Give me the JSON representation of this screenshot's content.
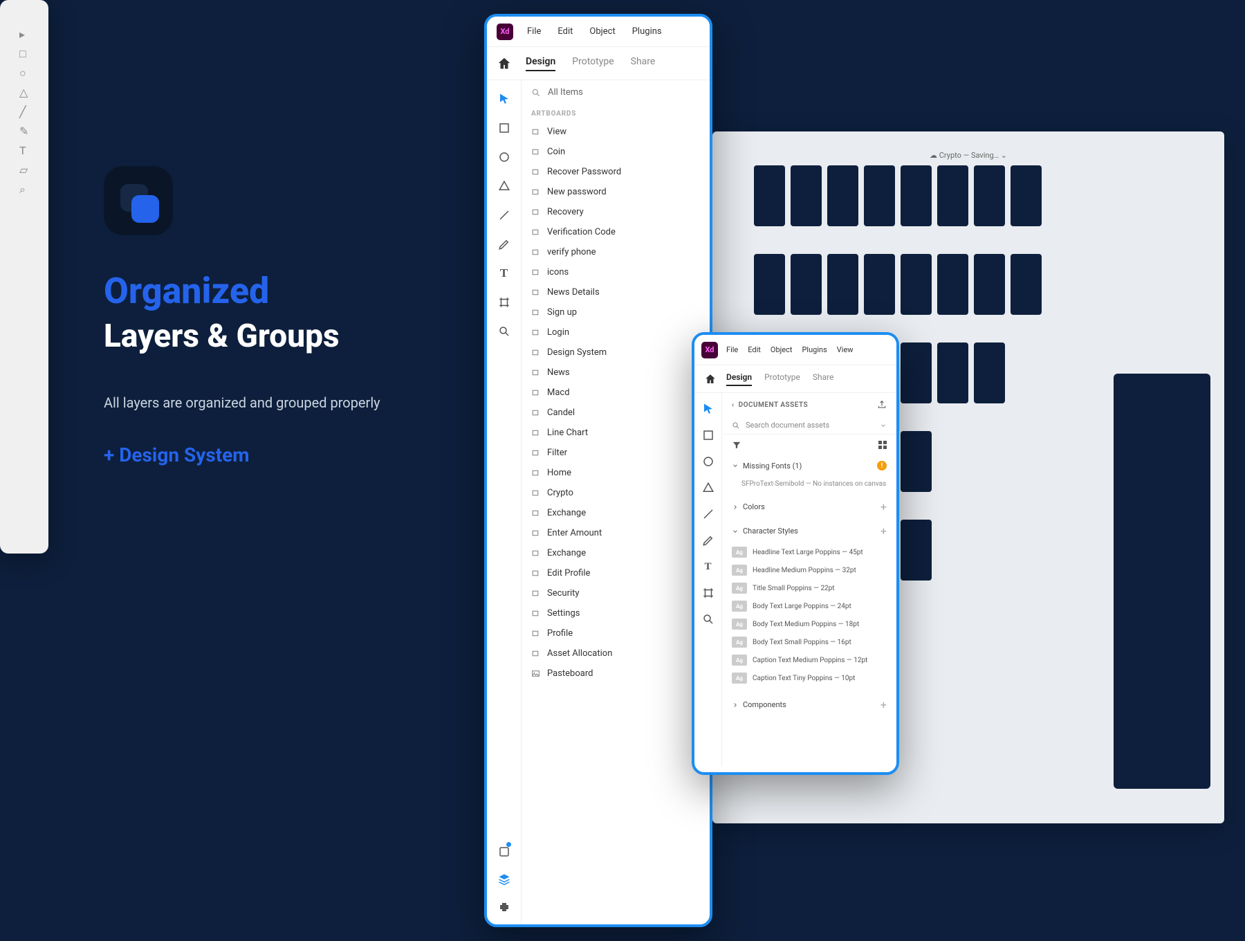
{
  "marketing": {
    "h1": "Organized",
    "h2": "Layers & Groups",
    "desc": "All layers are organized and grouped properly",
    "tag": "+ Design System"
  },
  "xd": {
    "logo": "Xd",
    "menu": {
      "file": "File",
      "edit": "Edit",
      "object": "Object",
      "plugins": "Plugins",
      "view": "View"
    },
    "tabs": {
      "design": "Design",
      "prototype": "Prototype",
      "share": "Share"
    }
  },
  "layers": {
    "search": "All Items",
    "section": "ARTBOARDS",
    "items": [
      "View",
      "Coin",
      "Recover Password",
      "New password",
      "Recovery",
      "Verification Code",
      "verify phone",
      "icons",
      "News Details",
      "Sign up",
      "Login",
      "Design System",
      "News",
      "Macd",
      "Candel",
      "Line Chart",
      "Filter",
      "Home",
      "Crypto",
      "Exchange",
      "Enter Amount",
      "Exchange",
      "Edit Profile",
      "Security",
      "Settings",
      "Profile",
      "Asset Allocation",
      "Pasteboard"
    ]
  },
  "assets": {
    "docAssets": "DOCUMENT ASSETS",
    "back_sym": "‹",
    "search": "Search document assets",
    "missingFonts": "Missing Fonts (1)",
    "missingFontDetail": "SFProText-Semibold — No instances on canvas",
    "colors": "Colors",
    "charStyles": "Character Styles",
    "styles": [
      "Headline Text Large Poppins — 45pt",
      "Headline Medium Poppins — 32pt",
      "Title Small Poppins — 22pt",
      "Body Text Large Poppins — 24pt",
      "Body Text Medium Poppins — 18pt",
      "Body Text Small Poppins — 16pt",
      "Caption Text Medium Poppins — 12pt",
      "Caption Text Tiny Poppins — 10pt"
    ],
    "swatch": "Ag",
    "components": "Components"
  },
  "canvas": {
    "projectName": "Crypto",
    "status": "— Saving…",
    "caret": "⌄"
  }
}
